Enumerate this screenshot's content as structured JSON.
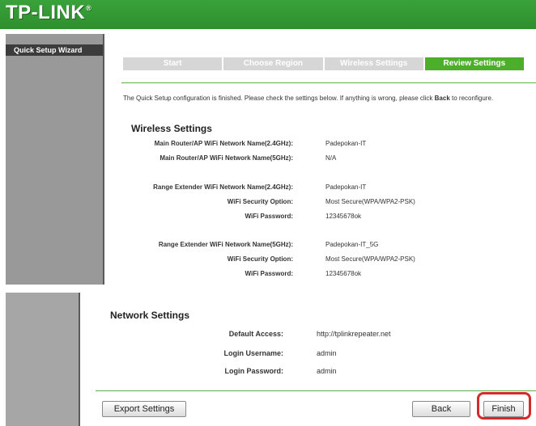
{
  "brand": {
    "name": "TP-LINK",
    "reg": "®"
  },
  "sidebar": {
    "title": "Quick Setup Wizard"
  },
  "steps": [
    "Start",
    "Choose Region",
    "Wireless Settings",
    "Review Settings"
  ],
  "intro": {
    "before": "The Quick Setup configuration is finished. Please check the settings below. If anything is wrong, please click ",
    "bold": "Back",
    "after": " to reconfigure."
  },
  "wireless": {
    "title": "Wireless Settings",
    "rows": [
      {
        "label": "Main Router/AP WiFi Network Name(2.4GHz):",
        "value": "Padepokan-IT"
      },
      {
        "label": "Main Router/AP WiFi Network Name(5GHz):",
        "value": "N/A"
      },
      {
        "label": "Range Extender WiFi Network Name(2.4GHz):",
        "value": "Padepokan-IT"
      },
      {
        "label": "WiFi Security Option:",
        "value": "Most Secure(WPA/WPA2-PSK)"
      },
      {
        "label": "WiFi Password:",
        "value": "12345678ok"
      },
      {
        "label": "Range Extender WiFi Network Name(5GHz):",
        "value": "Padepokan-IT_5G"
      },
      {
        "label": "WiFi Security Option:",
        "value": "Most Secure(WPA/WPA2-PSK)"
      },
      {
        "label": "WiFi Password:",
        "value": "12345678ok"
      }
    ]
  },
  "network": {
    "title": "Network Settings",
    "rows": [
      {
        "label": "Default Access:",
        "value": "http://tplinkrepeater.net"
      },
      {
        "label": "Login Username:",
        "value": "admin"
      },
      {
        "label": "Login Password:",
        "value": "admin"
      }
    ]
  },
  "buttons": {
    "export": "Export Settings",
    "back": "Back",
    "finish": "Finish"
  },
  "colors": {
    "header_green": "#2d8f2d",
    "active_step": "#4caf2a",
    "highlight": "#d42a2a"
  }
}
